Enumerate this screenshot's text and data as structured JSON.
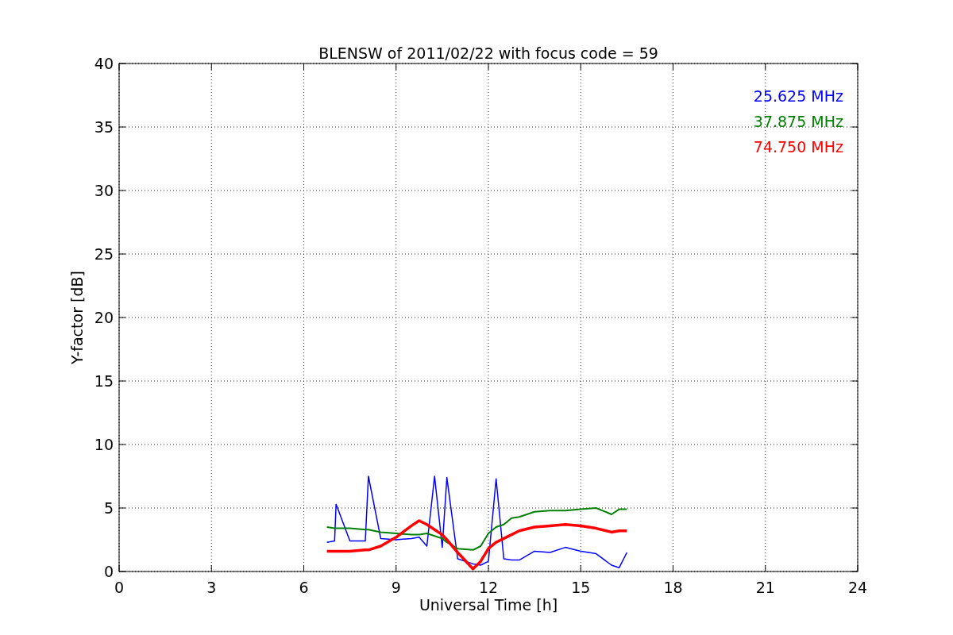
{
  "chart_data": {
    "type": "line",
    "title": "BLENSW of 2011/02/22 with focus code = 59",
    "xlabel": "Universal Time [h]",
    "ylabel": "Y-factor [dB]",
    "x": [
      6.75,
      7,
      7.05,
      7.5,
      8,
      8.1,
      8.5,
      9,
      9.5,
      9.75,
      10,
      10.25,
      10.5,
      10.65,
      11,
      11.5,
      11.75,
      12,
      12.25,
      12.5,
      12.75,
      13,
      13.5,
      14,
      14.5,
      15,
      15.5,
      16,
      16.25,
      16.5
    ],
    "series": [
      {
        "name": "25.625 MHz",
        "color": "#0000ff",
        "values": [
          2.3,
          2.4,
          5.3,
          2.4,
          2.4,
          7.5,
          2.6,
          2.5,
          2.6,
          2.7,
          2.0,
          7.5,
          1.9,
          7.4,
          1.0,
          0.6,
          0.5,
          0.8,
          7.3,
          1.0,
          0.9,
          0.9,
          1.6,
          1.5,
          1.9,
          1.6,
          1.4,
          0.5,
          0.3,
          1.5
        ]
      },
      {
        "name": "37.875 MHz",
        "color": "#008000",
        "values": [
          3.5,
          3.4,
          3.4,
          3.4,
          3.3,
          3.3,
          3.1,
          3.0,
          2.9,
          2.9,
          3.0,
          2.8,
          2.6,
          2.3,
          1.8,
          1.7,
          2.0,
          3.0,
          3.5,
          3.7,
          4.2,
          4.3,
          4.7,
          4.8,
          4.8,
          4.9,
          5.0,
          4.5,
          4.9,
          4.9
        ]
      },
      {
        "name": "74.750 MHz",
        "color": "#ff0000",
        "values": [
          1.6,
          1.6,
          1.6,
          1.6,
          1.7,
          1.7,
          2.0,
          2.7,
          3.6,
          4.0,
          3.7,
          3.3,
          2.9,
          2.5,
          1.5,
          0.2,
          0.8,
          1.8,
          2.3,
          2.6,
          2.9,
          3.2,
          3.5,
          3.6,
          3.7,
          3.6,
          3.4,
          3.1,
          3.2,
          3.2
        ]
      }
    ],
    "xlim": [
      0,
      24
    ],
    "ylim": [
      0,
      40
    ],
    "xticks": [
      0,
      3,
      6,
      9,
      12,
      15,
      18,
      21,
      24
    ],
    "yticks": [
      0,
      5,
      10,
      15,
      20,
      25,
      30,
      35,
      40
    ],
    "grid": true
  }
}
